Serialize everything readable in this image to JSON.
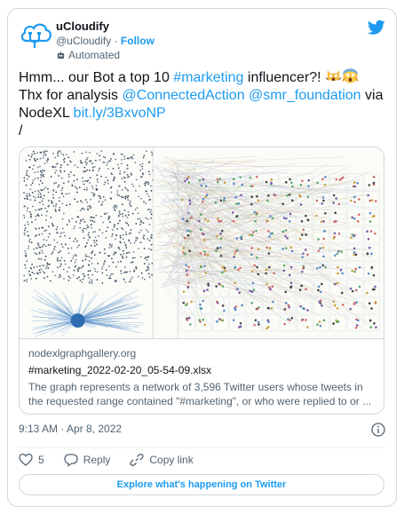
{
  "author": {
    "name": "uCloudify",
    "handle": "@uCloudify",
    "separator": "·",
    "follow_label": "Follow",
    "automated_label": "Automated"
  },
  "tweet": {
    "line1_prefix": "Hmm... our Bot a top 10 ",
    "hashtag": "#marketing",
    "line1_suffix": " influencer?! ",
    "emoji_1": "scream-cat-emoji",
    "emoji_2": "scream-face-emoji",
    "line2_prefix": "Thx for analysis ",
    "mention_1": "@ConnectedAction",
    "mention_2": "@smr_foundation",
    "line2_suffix": " via",
    "line3_prefix": "NodeXL ",
    "short_link": "bit.ly/3BxvoNP",
    "line4": "/"
  },
  "card": {
    "image_icon": "network-graph-image",
    "domain": "nodexlgraphgallery.org",
    "title": "#marketing_2022-02-20_05-54-09.xlsx",
    "description": "The graph represents a network of 3,596 Twitter users whose tweets in the requested range contained \"#marketing\", or who were replied to or ..."
  },
  "meta": {
    "time": "9:13 AM · Apr 8, 2022"
  },
  "actions": {
    "like_count": "5",
    "reply_label": "Reply",
    "copy_label": "Copy link"
  },
  "explore_label": "Explore what's happening on Twitter",
  "colors": {
    "accent": "#1d9bf0",
    "text": "#0f1419",
    "muted": "#536471",
    "border": "#cfd9de"
  }
}
